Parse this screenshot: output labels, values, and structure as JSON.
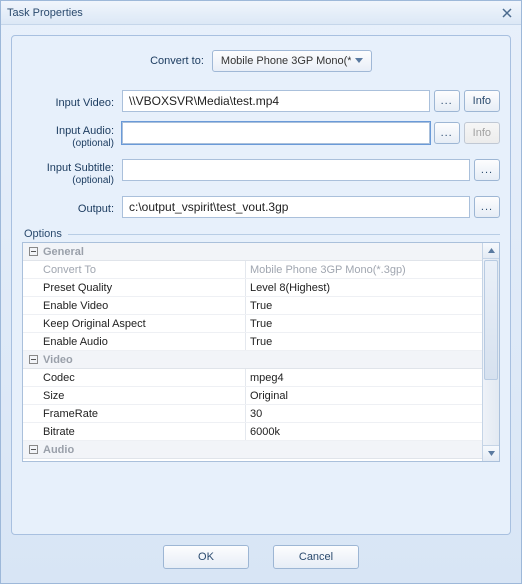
{
  "window": {
    "title": "Task Properties"
  },
  "convert": {
    "label": "Convert to:",
    "selected": "Mobile Phone 3GP Mono(*.3g"
  },
  "inputVideo": {
    "label": "Input Video:",
    "value": "\\\\VBOXSVR\\Media\\test.mp4",
    "browse": "...",
    "info": "Info"
  },
  "inputAudio": {
    "label": "Input Audio:",
    "sublabel": "(optional)",
    "value": "",
    "browse": "...",
    "info": "Info"
  },
  "inputSubtitle": {
    "label": "Input Subtitle:",
    "sublabel": "(optional)",
    "value": "",
    "browse": "..."
  },
  "output": {
    "label": "Output:",
    "value": "c:\\output_vspirit\\test_vout.3gp",
    "browse": "..."
  },
  "optionsLabel": "Options",
  "sections": {
    "general": {
      "title": "General",
      "rows": [
        {
          "label": "Convert To",
          "value": "Mobile Phone 3GP Mono(*.3gp)",
          "disabled": true
        },
        {
          "label": "Preset Quality",
          "value": "Level 8(Highest)"
        },
        {
          "label": "Enable Video",
          "value": "True"
        },
        {
          "label": "Keep Original Aspect",
          "value": "True"
        },
        {
          "label": "Enable Audio",
          "value": "True"
        }
      ]
    },
    "video": {
      "title": "Video",
      "rows": [
        {
          "label": "Codec",
          "value": "mpeg4"
        },
        {
          "label": "Size",
          "value": "Original"
        },
        {
          "label": "FrameRate",
          "value": "30"
        },
        {
          "label": "Bitrate",
          "value": "6000k"
        }
      ]
    },
    "audio": {
      "title": "Audio"
    }
  },
  "buttons": {
    "ok": "OK",
    "cancel": "Cancel"
  }
}
